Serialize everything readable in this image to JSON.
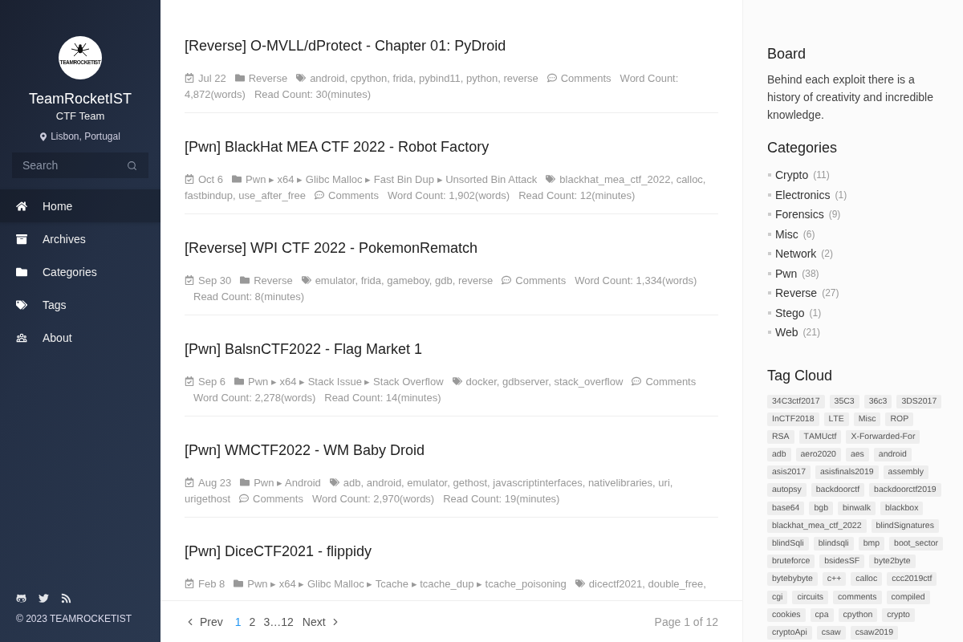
{
  "sidebar": {
    "logo_text": "TEAMROCKETIST",
    "title": "TeamRocketIST",
    "subtitle": "CTF Team",
    "location": "Lisbon, Portugal",
    "search": {
      "placeholder": "Search"
    },
    "nav": [
      {
        "label": "Home",
        "selected": true
      },
      {
        "label": "Archives",
        "selected": false
      },
      {
        "label": "Categories",
        "selected": false
      },
      {
        "label": "Tags",
        "selected": false
      },
      {
        "label": "About",
        "selected": false
      }
    ],
    "copyright": "© 2023 TEAMROCKETIST"
  },
  "posts": [
    {
      "title": "[Reverse] O-MVLL/dProtect - Chapter 01: PyDroid",
      "date": "Jul 22",
      "categories": "Reverse",
      "tags": [
        "android,",
        "cpython,",
        "frida,",
        "pybind11,",
        "python,",
        "reverse"
      ],
      "comments": "Comments",
      "word_count": {
        "label": "Word Count:",
        "value": "4,872(words)"
      },
      "read_count": "Read Count: 30(minutes)"
    },
    {
      "title": "[Pwn] BlackHat MEA CTF 2022 - Robot Factory",
      "date": "Oct 6",
      "categories": "Pwn ▸ x64 ▸ Glibc Malloc ▸ Fast Bin Dup ▸ Unsorted Bin Attack",
      "tags": [
        "blackhat_mea_ctf_2022,",
        "calloc,",
        "fastbindup,",
        "use_after_free"
      ],
      "comments": "Comments",
      "word_count": {
        "label": "Word Count:",
        "value": "1,902(words)"
      },
      "read_count": "Read Count: 12(minutes)"
    },
    {
      "title": "[Reverse] WPI CTF 2022 - PokemonRematch",
      "date": "Sep 30",
      "categories": "Reverse",
      "tags": [
        "emulator,",
        "frida,",
        "gameboy,",
        "gdb,",
        "reverse"
      ],
      "comments": "Comments",
      "word_count": {
        "label": "Word Count:",
        "value": "1,334(words)"
      },
      "read_count": "Read Count: 8(minutes)"
    },
    {
      "title": "[Pwn] BalsnCTF2022 - Flag Market 1",
      "date": "Sep 6",
      "categories": "Pwn ▸ x64 ▸ Stack Issue ▸ Stack Overflow",
      "tags": [
        "docker,",
        "gdbserver,",
        "stack_overflow"
      ],
      "comments": "Comments",
      "word_count": {
        "label": "Word Count:",
        "value": "2,278(words)"
      },
      "read_count": "Read Count: 14(minutes)"
    },
    {
      "title": "[Pwn] WMCTF2022 - WM Baby Droid",
      "date": "Aug 23",
      "categories": "Pwn ▸ Android",
      "tags": [
        "adb,",
        "android,",
        "emulator,",
        "gethost,",
        "javascriptinterfaces,",
        "nativelibraries,",
        "uri,",
        "urigethost"
      ],
      "comments": "Comments",
      "word_count": {
        "label": "Word Count:",
        "value": "2,970(words)"
      },
      "read_count": "Read Count: 19(minutes)"
    },
    {
      "title": "[Pwn] DiceCTF2021 - flippidy",
      "date": "Feb 8",
      "categories": "Pwn ▸ x64 ▸ Glibc Malloc ▸ Tcache ▸ tcache_dup ▸ tcache_poisoning",
      "tags": [
        "dicectf2021,",
        "double_free,"
      ]
    }
  ],
  "pagination": {
    "prev": "Prev",
    "pages": [
      {
        "kind": "page",
        "label": "1",
        "selected": true
      },
      {
        "kind": "page",
        "label": "2",
        "selected": false
      },
      {
        "kind": "page",
        "label": "3",
        "selected": false
      },
      {
        "kind": "ellipsis",
        "label": "…"
      },
      {
        "kind": "page",
        "label": "12",
        "selected": false
      }
    ],
    "next": "Next",
    "summary": "Page 1 of 12"
  },
  "aside": {
    "board": {
      "title": "Board",
      "text": "Behind each exploit there is a history of creativity and incredible knowledge."
    },
    "categories": {
      "title": "Categories",
      "items": [
        {
          "name": "Crypto",
          "count": "(11)"
        },
        {
          "name": "Electronics",
          "count": "(1)"
        },
        {
          "name": "Forensics",
          "count": "(9)"
        },
        {
          "name": "Misc",
          "count": "(6)"
        },
        {
          "name": "Network",
          "count": "(2)"
        },
        {
          "name": "Pwn",
          "count": "(38)"
        },
        {
          "name": "Reverse",
          "count": "(27)"
        },
        {
          "name": "Stego",
          "count": "(1)"
        },
        {
          "name": "Web",
          "count": "(21)"
        }
      ]
    },
    "tag_cloud": {
      "title": "Tag Cloud",
      "tags": [
        "34C3ctf2017",
        "35C3",
        "36c3",
        "3DS2017",
        "InCTF2018",
        "LTE",
        "Misc",
        "ROP",
        "RSA",
        "TAMUctf",
        "X-Forwarded-For",
        "adb",
        "aero2020",
        "aes",
        "android",
        "asis2017",
        "asisfinals2019",
        "assembly",
        "autopsy",
        "backdoorctf",
        "backdoorctf2019",
        "base64",
        "bgb",
        "binwalk",
        "blackbox",
        "blackhat_mea_ctf_2022",
        "blindSignatures",
        "blindSqli",
        "blindsqli",
        "bmp",
        "boot_sector",
        "bruteforce",
        "bsidesSF",
        "byte2byte",
        "bytebybyte",
        "c++",
        "calloc",
        "ccc2019ctf",
        "cgi",
        "circuits",
        "comments",
        "compiled",
        "cookies",
        "cpa",
        "cpython",
        "crypto",
        "cryptoApi",
        "csaw",
        "csaw2019"
      ]
    }
  }
}
